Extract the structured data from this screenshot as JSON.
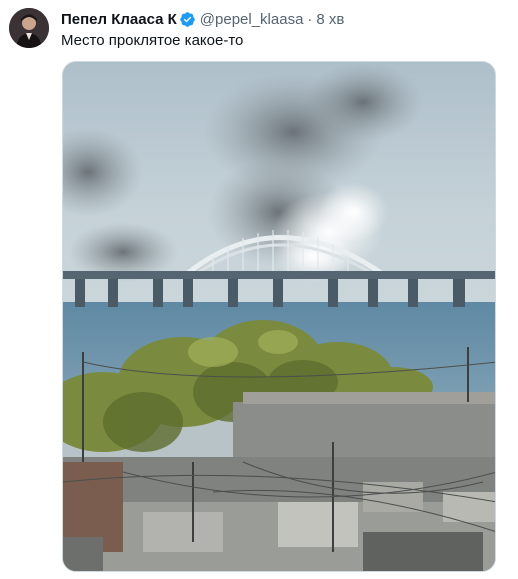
{
  "tweet": {
    "author_name": "Пепел Клааса К",
    "verified_icon": "verified-badge-icon",
    "handle": "@pepel_klaasa",
    "separator": "·",
    "time": "8 хв",
    "text": "Место проклятое какое-то",
    "colors": {
      "verified": "#1d9bf0",
      "secondary_text": "#536471"
    }
  }
}
